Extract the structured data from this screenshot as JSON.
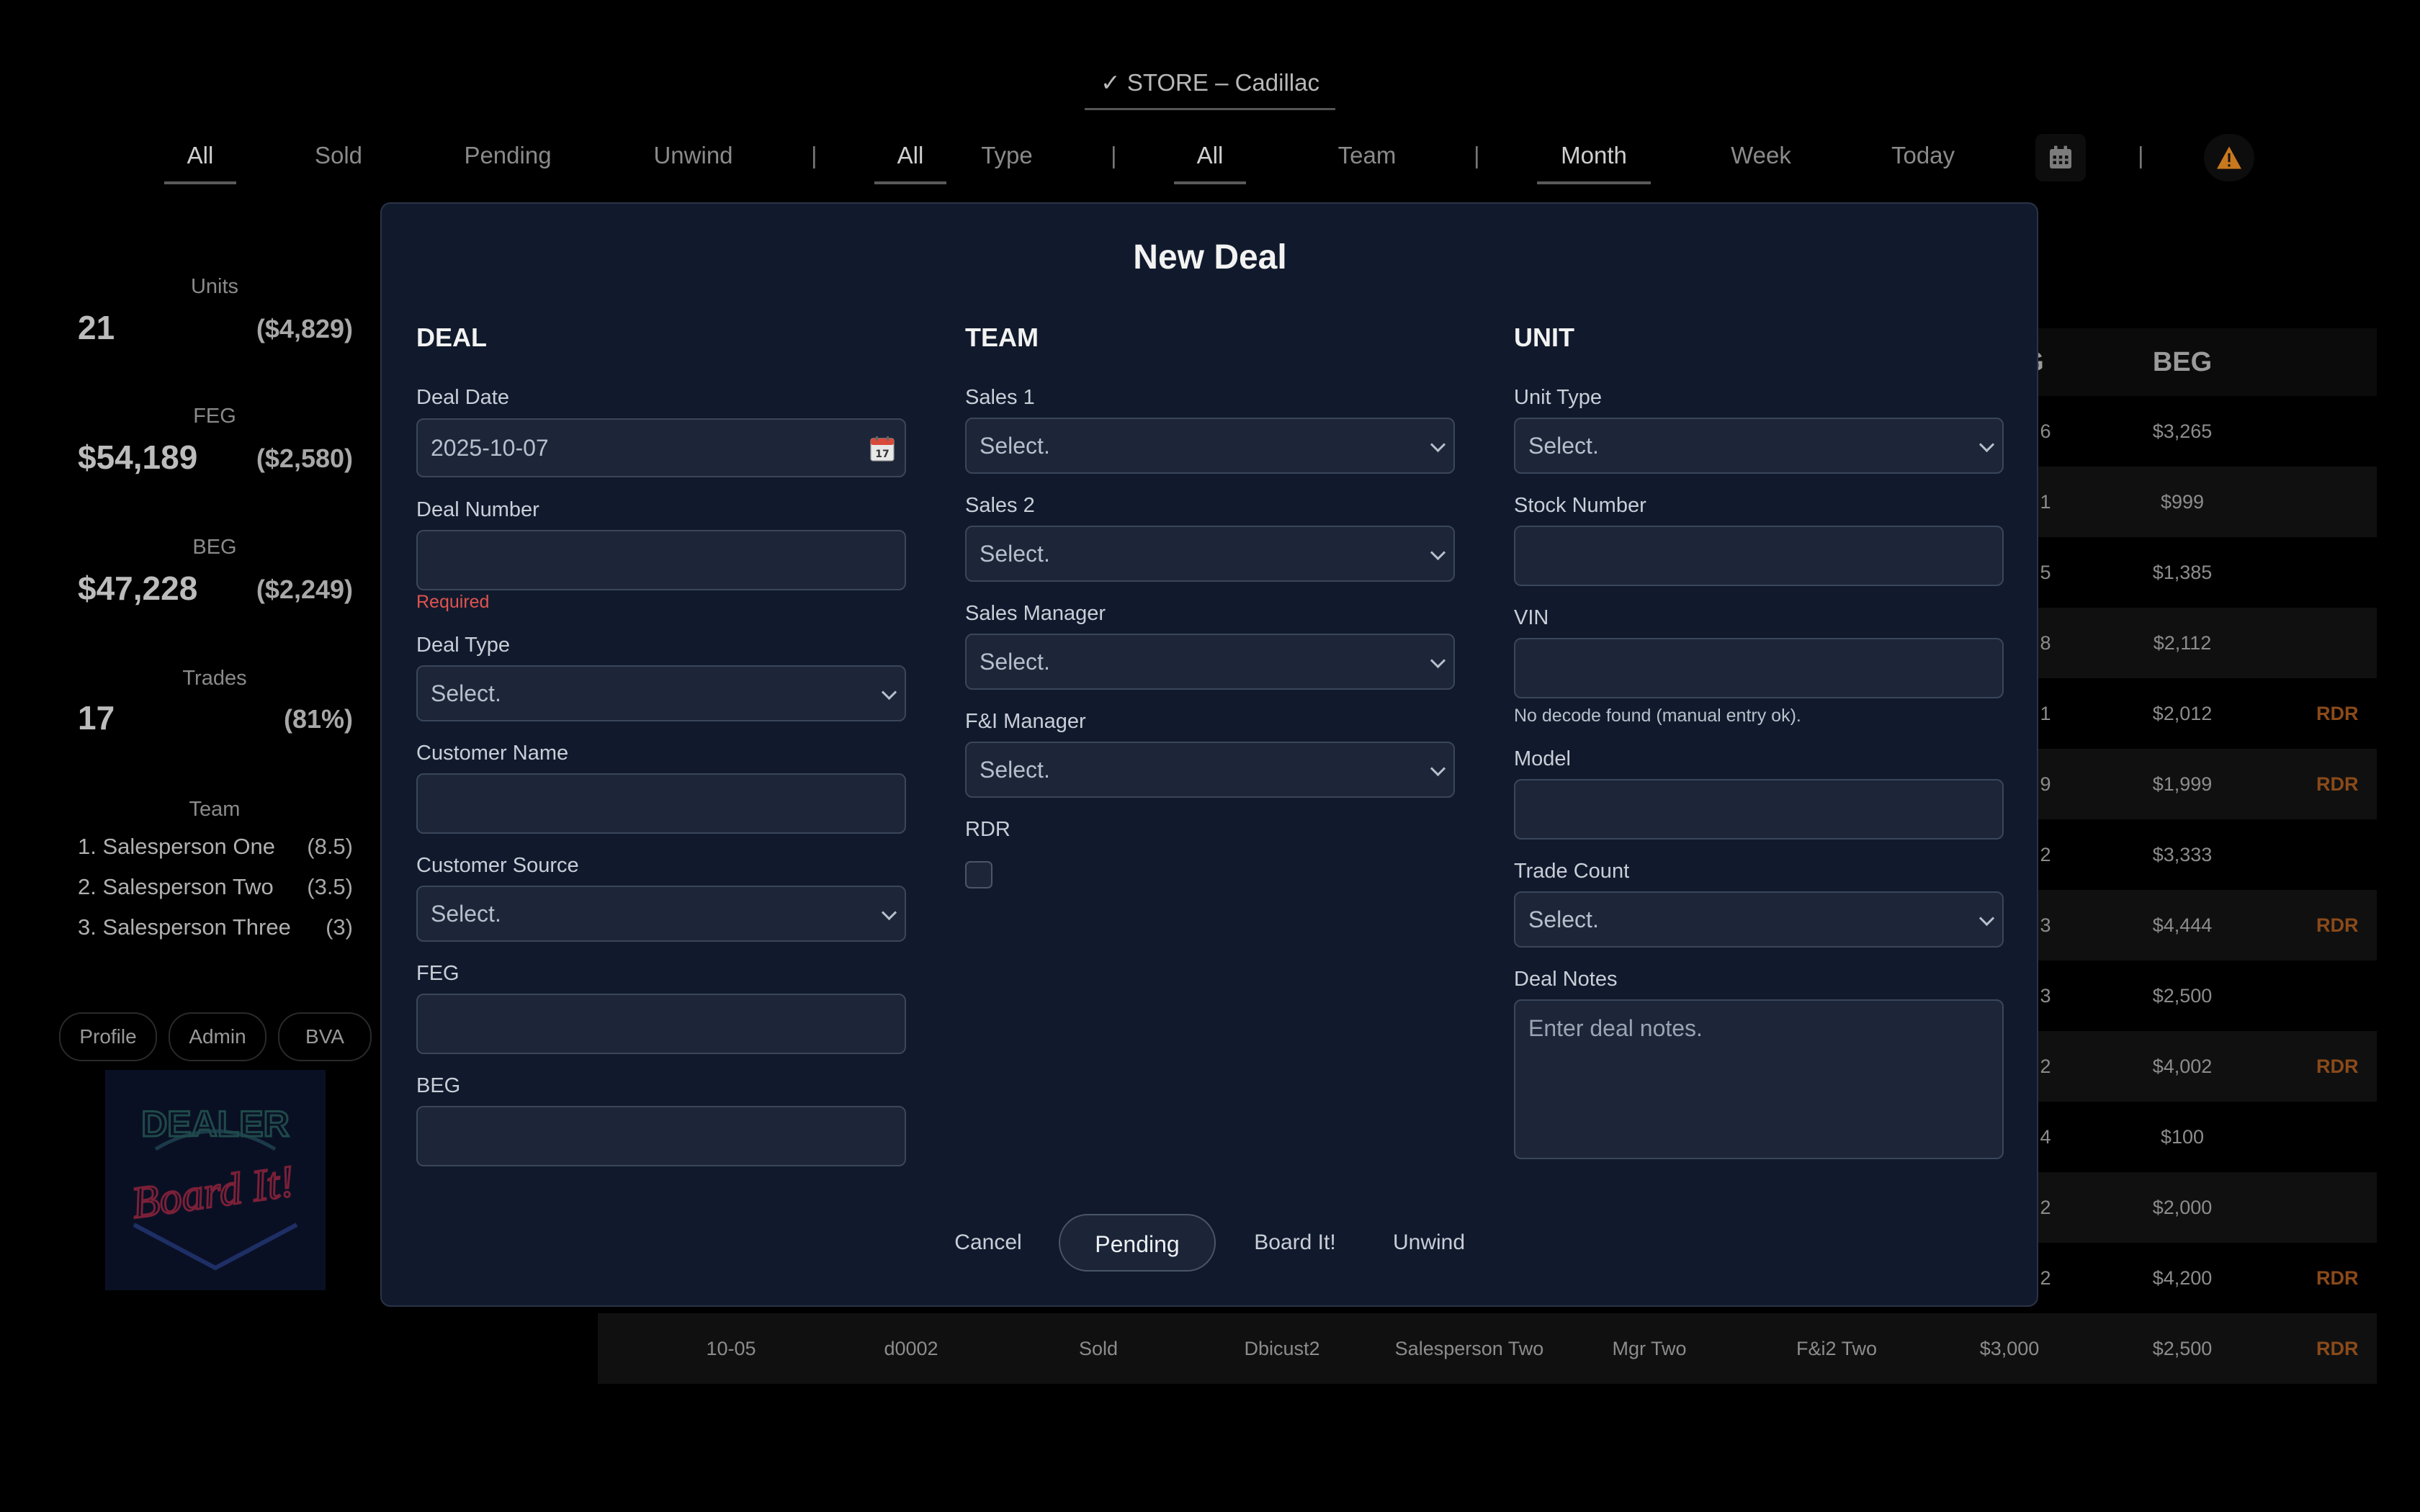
{
  "store": {
    "label": "✓ STORE – Cadillac"
  },
  "filters": {
    "status": [
      "All",
      "Sold",
      "Pending",
      "Unwind"
    ],
    "type": [
      "All",
      "Type"
    ],
    "team": [
      "All",
      "Team"
    ],
    "period": [
      "Month",
      "Week",
      "Today"
    ],
    "separator": "|"
  },
  "sidebar": {
    "units": {
      "label": "Units",
      "value": "21",
      "sub": "($4,829)"
    },
    "feg": {
      "label": "FEG",
      "value": "$54,189",
      "sub": "($2,580)"
    },
    "beg": {
      "label": "BEG",
      "value": "$47,228",
      "sub": "($2,249)"
    },
    "trades": {
      "label": "Trades",
      "value": "17",
      "sub": "(81%)"
    },
    "team": {
      "label": "Team",
      "items": [
        {
          "name": "1. Salesperson One",
          "value": "(8.5)"
        },
        {
          "name": "2. Salesperson Two",
          "value": "(3.5)"
        },
        {
          "name": "3. Salesperson Three",
          "value": "(3)"
        }
      ]
    },
    "buttons": [
      "Profile",
      "Admin",
      "BVA"
    ],
    "logo": {
      "line1": "DEALER",
      "line2": "Board It!"
    }
  },
  "table": {
    "head_partial": "G",
    "head_beg": "BEG",
    "rows": [
      {
        "g": "6",
        "beg": "$3,265",
        "rdr": ""
      },
      {
        "g": "1",
        "beg": "$999",
        "rdr": ""
      },
      {
        "g": "5",
        "beg": "$1,385",
        "rdr": ""
      },
      {
        "g": "8",
        "beg": "$2,112",
        "rdr": ""
      },
      {
        "g": "1",
        "beg": "$2,012",
        "rdr": "RDR"
      },
      {
        "g": "9",
        "beg": "$1,999",
        "rdr": "RDR"
      },
      {
        "g": "2",
        "beg": "$3,333",
        "rdr": ""
      },
      {
        "g": "3",
        "beg": "$4,444",
        "rdr": "RDR"
      },
      {
        "g": "3",
        "beg": "$2,500",
        "rdr": ""
      },
      {
        "g": "2",
        "beg": "$4,002",
        "rdr": "RDR"
      },
      {
        "g": "4",
        "beg": "$100",
        "rdr": ""
      },
      {
        "g": "2",
        "beg": "$2,000",
        "rdr": ""
      },
      {
        "g": "2",
        "beg": "$4,200",
        "rdr": "RDR"
      }
    ],
    "last_row": {
      "date": "10-05",
      "number": "d0002",
      "status": "Sold",
      "customer": "Dbicust2",
      "sales": "Salesperson Two",
      "manager": "Mgr Two",
      "fi": "F&i2 Two",
      "feg": "$3,000",
      "beg": "$2,500",
      "rdr": "RDR"
    }
  },
  "modal": {
    "title": "New Deal",
    "deal": {
      "heading": "DEAL",
      "deal_date_label": "Deal Date",
      "deal_date_value": "2025-10-07",
      "deal_number_label": "Deal Number",
      "deal_number_value": "",
      "required_text": "Required",
      "deal_type_label": "Deal Type",
      "deal_type_value": "Select.",
      "customer_name_label": "Customer Name",
      "customer_name_value": "",
      "customer_source_label": "Customer Source",
      "customer_source_value": "Select.",
      "feg_label": "FEG",
      "feg_value": "",
      "beg_label": "BEG",
      "beg_value": ""
    },
    "team": {
      "heading": "TEAM",
      "sales1_label": "Sales 1",
      "sales1_value": "Select.",
      "sales2_label": "Sales 2",
      "sales2_value": "Select.",
      "sales_manager_label": "Sales Manager",
      "sales_manager_value": "Select.",
      "fi_manager_label": "F&I Manager",
      "fi_manager_value": "Select.",
      "rdr_label": "RDR",
      "rdr_checked": false
    },
    "unit": {
      "heading": "UNIT",
      "unit_type_label": "Unit Type",
      "unit_type_value": "Select.",
      "stock_number_label": "Stock Number",
      "stock_number_value": "",
      "vin_label": "VIN",
      "vin_value": "",
      "vin_hint": "No decode found (manual entry ok).",
      "model_label": "Model",
      "model_value": "",
      "trade_count_label": "Trade Count",
      "trade_count_value": "Select.",
      "deal_notes_label": "Deal Notes",
      "deal_notes_placeholder": "Enter deal notes."
    },
    "actions": {
      "cancel": "Cancel",
      "pending": "Pending",
      "board": "Board It!",
      "unwind": "Unwind"
    }
  },
  "colors": {
    "modal_bg": "#111a2c",
    "field_bg": "#1c2638",
    "required": "#e0534f",
    "rdr": "#8a4a1a",
    "warning": "#c8781e"
  }
}
